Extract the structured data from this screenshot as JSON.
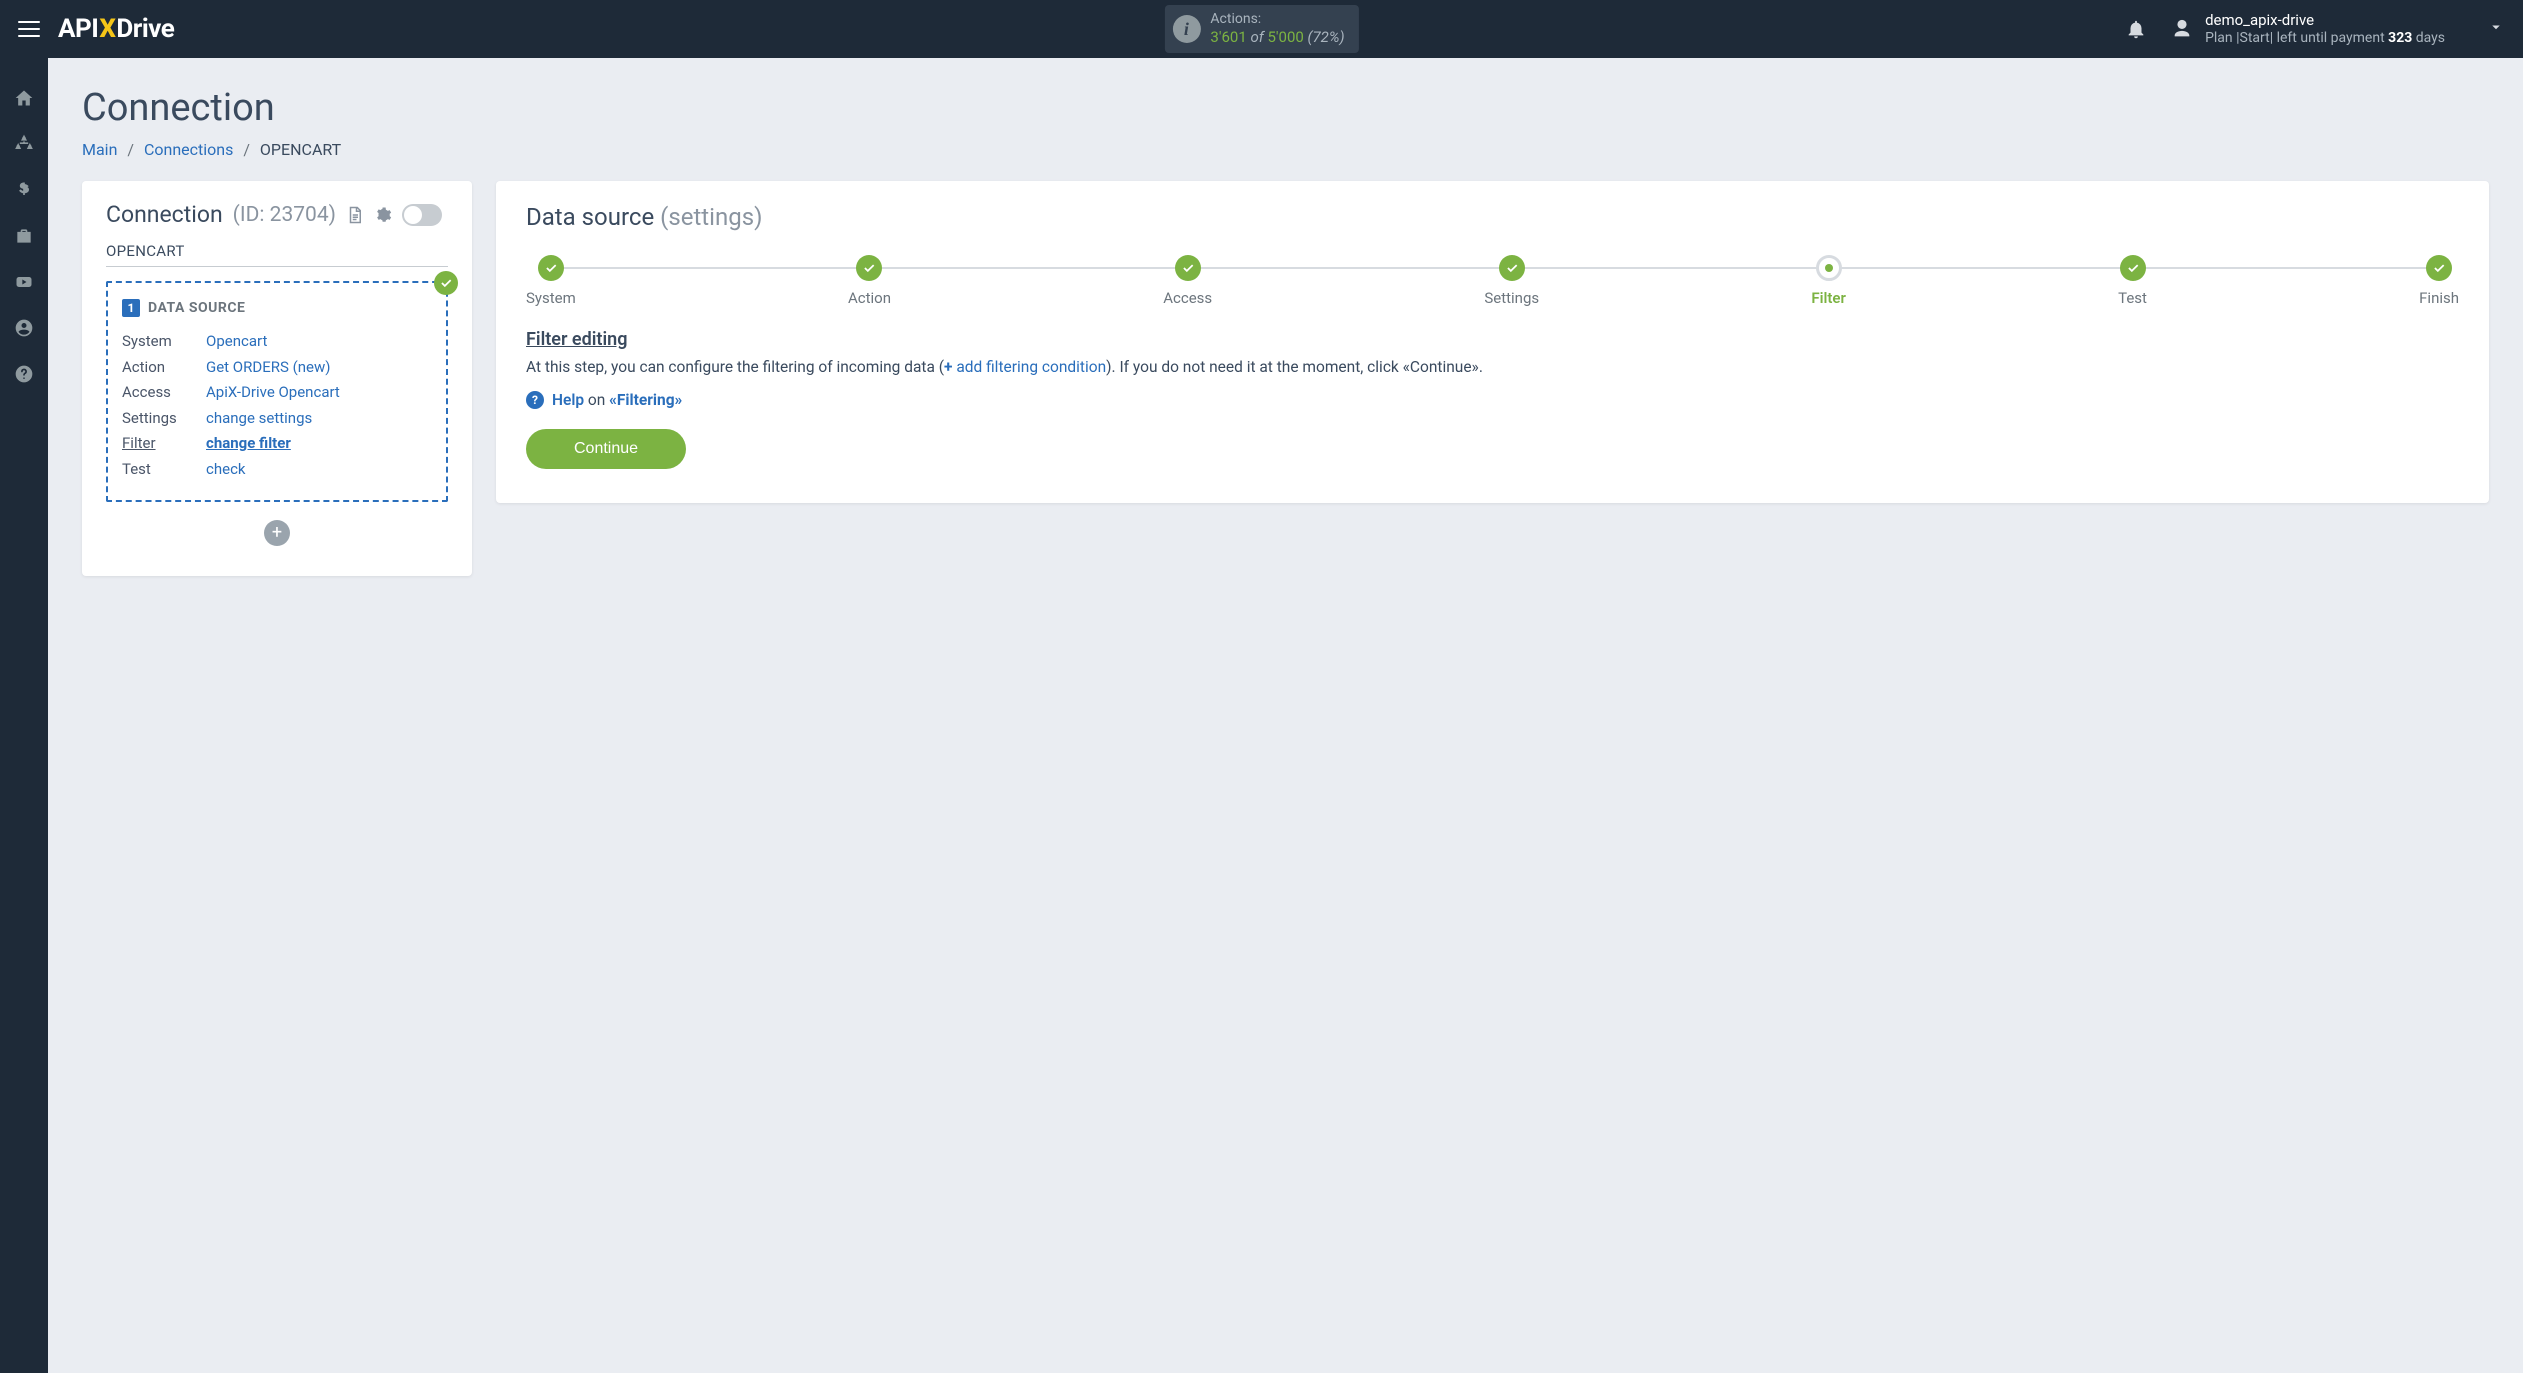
{
  "header": {
    "actions_label": "Actions:",
    "actions_used": "3'601",
    "actions_of": " of ",
    "actions_limit": "5'000",
    "actions_pct": " (72%)",
    "user_name": "demo_apix-drive",
    "plan_prefix": "Plan |Start| left until payment ",
    "plan_days_n": "323",
    "plan_days_suffix": " days"
  },
  "page": {
    "title": "Connection",
    "breadcrumb_main": "Main",
    "breadcrumb_connections": "Connections",
    "breadcrumb_current": "OPENCART"
  },
  "left": {
    "conn_title": "Connection",
    "conn_id_label": "(ID: 23704)",
    "subtitle": "OPENCART",
    "source_badge": "1",
    "source_hdr": "DATA SOURCE",
    "rows": {
      "system_k": "System",
      "system_v": "Opencart",
      "action_k": "Action",
      "action_v": "Get ORDERS (new)",
      "access_k": "Access",
      "access_v": "ApiX-Drive Opencart",
      "settings_k": "Settings",
      "settings_v": "change settings",
      "filter_k": "Filter",
      "filter_v": "change filter",
      "test_k": "Test",
      "test_v": "check"
    }
  },
  "right": {
    "head_main": "Data source",
    "head_muted": "(settings)",
    "steps": {
      "s1": "System",
      "s2": "Action",
      "s3": "Access",
      "s4": "Settings",
      "s5": "Filter",
      "s6": "Test",
      "s7": "Finish"
    },
    "filter_title": "Filter editing",
    "desc_1": "At this step, you can configure the filtering of incoming data (",
    "desc_plus": "+",
    "desc_link": " add filtering condition",
    "desc_2": "). If you do not need it at the moment, click «Continue».",
    "help_label": "Help",
    "help_on": " on ",
    "help_topic": "«Filtering»",
    "continue": "Continue"
  }
}
